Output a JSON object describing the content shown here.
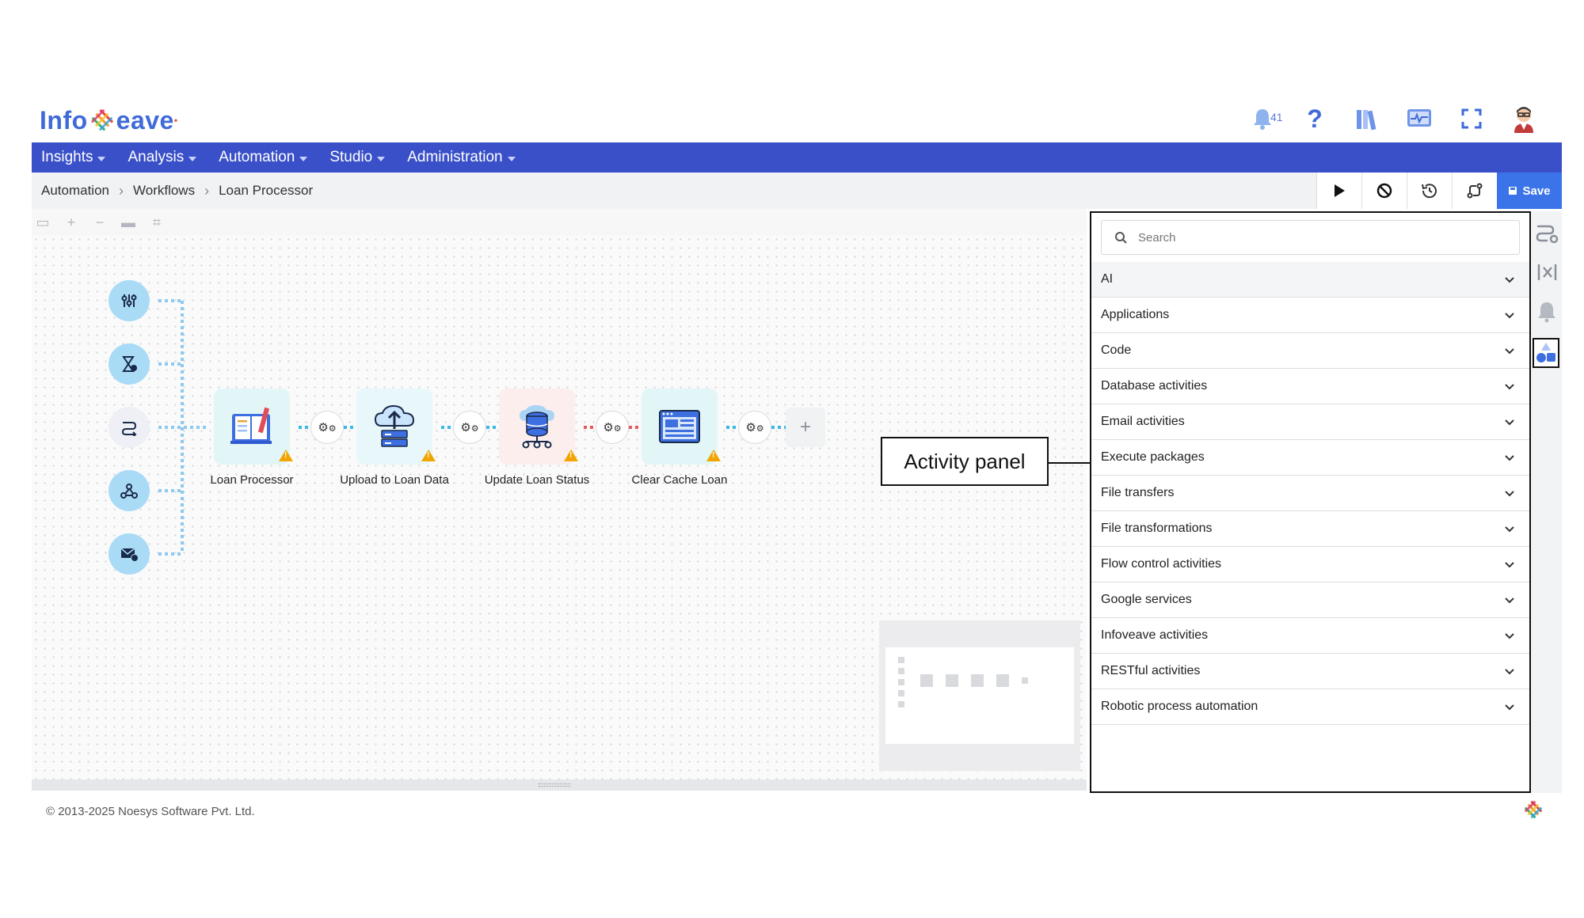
{
  "brand": {
    "logo_text_left": "Info",
    "logo_text_right": "eave"
  },
  "header": {
    "notification_count": "41"
  },
  "nav": {
    "items": [
      "Insights",
      "Analysis",
      "Automation",
      "Studio",
      "Administration"
    ]
  },
  "breadcrumb": {
    "items": [
      "Automation",
      "Workflows",
      "Loan Processor"
    ]
  },
  "toolbar": {
    "save_label": "Save"
  },
  "workflow": {
    "triggers": [
      "sliders-icon",
      "hourglass-icon",
      "route-icon",
      "webhook-icon",
      "email-check-icon"
    ],
    "nodes": [
      {
        "label": "Loan Processor",
        "icon": "book-pen-icon",
        "bg": "#e3f6f7"
      },
      {
        "label": "Upload to Loan Data",
        "icon": "cloud-upload-icon",
        "bg": "#e8f7fa"
      },
      {
        "label": "Update Loan Status",
        "icon": "database-network-icon",
        "bg": "#fdeeee"
      },
      {
        "label": "Clear Cache Loan",
        "icon": "dashboard-window-icon",
        "bg": "#e2f6f8"
      }
    ],
    "add_label": "+"
  },
  "callout": {
    "text": "Activity panel"
  },
  "panel": {
    "search_placeholder": "Search",
    "categories": [
      "AI",
      "Applications",
      "Code",
      "Database activities",
      "Email activities",
      "Execute packages",
      "File transfers",
      "File transformations",
      "Flow control activities",
      "Google services",
      "Infoveave activities",
      "RESTful activities",
      "Robotic process automation"
    ]
  },
  "footer": {
    "copyright": "© 2013-2025 Noesys Software Pvt. Ltd."
  },
  "colors": {
    "nav": "#3a50c8",
    "save": "#3b73e8",
    "trigger": "#a9dbf7",
    "connector_blue": "#3bb8e6",
    "connector_red": "#e8595a"
  }
}
